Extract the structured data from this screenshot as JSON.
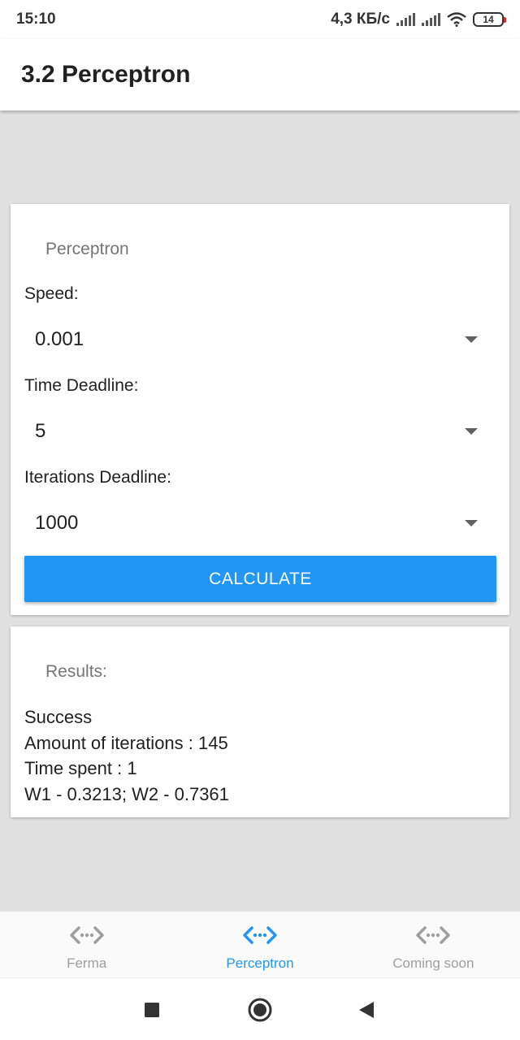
{
  "status_bar": {
    "time": "15:10",
    "network_speed": "4,3 КБ/с",
    "battery": "14",
    "icons": [
      "signal-icon",
      "signal-icon",
      "wifi-icon",
      "battery-icon"
    ]
  },
  "app_bar": {
    "title": "3.2 Perceptron"
  },
  "perceptron_card": {
    "heading": "Perceptron",
    "speed_label": "Speed:",
    "speed_value": "0.001",
    "time_deadline_label": "Time Deadline:",
    "time_deadline_value": "5",
    "iterations_deadline_label": "Iterations Deadline:",
    "iterations_deadline_value": "1000",
    "calculate_label": "CALCULATE",
    "accent_color": "#2196f3"
  },
  "results_card": {
    "heading": "Results:",
    "lines": [
      "Success",
      "Amount of iterations : 145",
      "Time spent : 1",
      "W1 - 0.3213; W2 - 0.7361"
    ]
  },
  "bottom_nav": {
    "items": [
      {
        "label": "Ferma",
        "icon": "code-arrows-icon",
        "active": false
      },
      {
        "label": "Perceptron",
        "icon": "code-arrows-icon",
        "active": true
      },
      {
        "label": "Coming soon",
        "icon": "code-arrows-icon",
        "active": false
      }
    ]
  },
  "system_nav": {
    "buttons": [
      "recents-square-icon",
      "home-circle-icon",
      "back-triangle-icon"
    ]
  }
}
